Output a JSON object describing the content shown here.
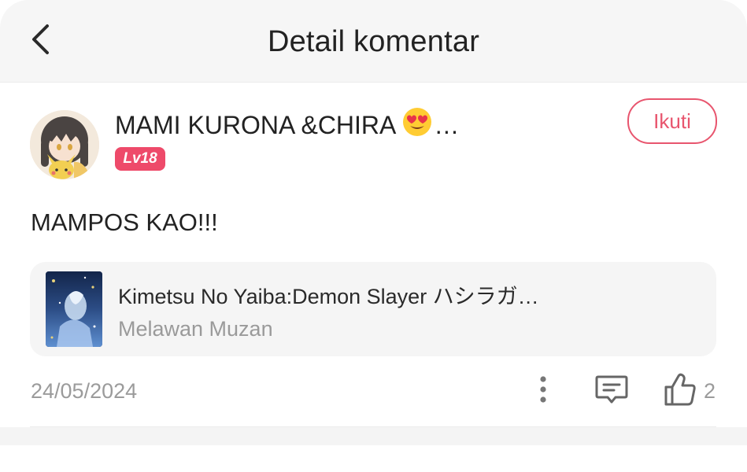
{
  "header": {
    "title": "Detail komentar",
    "back_icon": "chevron-left-icon"
  },
  "comment": {
    "user": {
      "name": "MAMI KURONA &CHIRA",
      "emoji": "😍",
      "ellipsis": "…",
      "level": "Lv18",
      "avatar_icon": "avatar-anime-girl-with-pikachu"
    },
    "follow_label": "Ikuti",
    "text": "MAMPOS KAO!!!",
    "work": {
      "title": "Kimetsu No Yaiba:Demon Slayer ハシラガ…",
      "subtitle": "Melawan Muzan",
      "cover_icon": "work-cover-image"
    },
    "date": "24/05/2024",
    "like_count": "2",
    "icons": {
      "more": "more-vertical-icon",
      "reply": "comment-icon",
      "like": "thumbs-up-icon"
    }
  },
  "colors": {
    "accent": "#e8556e",
    "badge": "#ee4a6a",
    "text_primary": "#222222",
    "text_secondary": "#9b9b9b",
    "card_bg": "#f5f5f5",
    "header_bg": "#f6f6f6"
  }
}
